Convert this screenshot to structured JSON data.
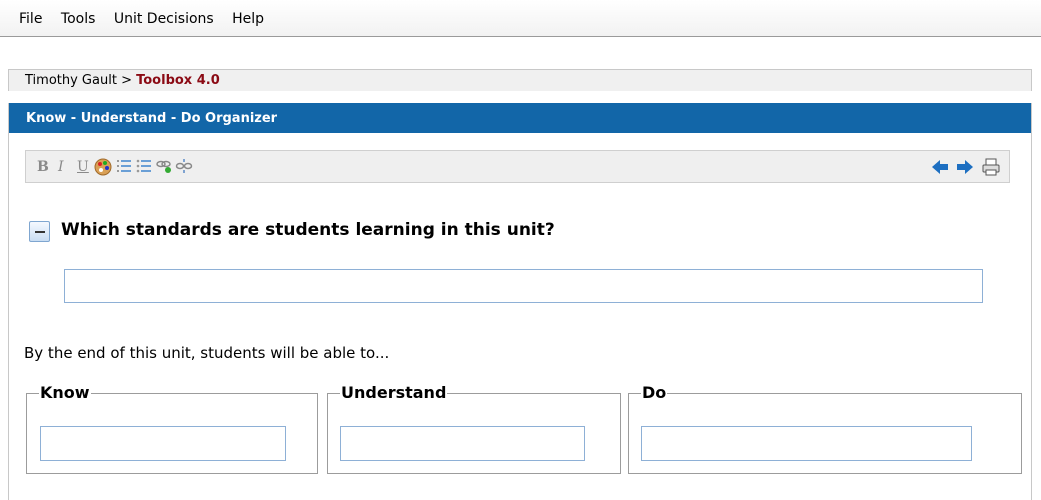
{
  "menu": [
    "File",
    "Tools",
    "Unit Decisions",
    "Help"
  ],
  "breadcrumb": {
    "user": "Timothy Gault",
    "separator": ">",
    "current": "Toolbox 4.0"
  },
  "panel": {
    "title": "Know - Understand - Do Organizer"
  },
  "toolbar": {
    "buttons": [
      "bold-icon",
      "italic-icon",
      "underline-icon",
      "color-palette-icon",
      "numbered-list-icon",
      "bulleted-list-icon",
      "link-icon",
      "unlink-icon"
    ],
    "nav": [
      "back-arrow-icon",
      "forward-arrow-icon",
      "print-icon"
    ],
    "colors": {
      "arrows": "#1d6fc1",
      "icons": "#8a8a8a"
    }
  },
  "question": {
    "text": "Which standards are students learning in this unit?",
    "value": ""
  },
  "intro": "By the end of this unit, students will be able to...",
  "columns": [
    {
      "label": "Know",
      "value": ""
    },
    {
      "label": "Understand",
      "value": ""
    },
    {
      "label": "Do",
      "value": ""
    }
  ],
  "colors": {
    "header": "#1266a8",
    "current_crumb": "#8b0a14",
    "input_border": "#8eb0d6"
  }
}
